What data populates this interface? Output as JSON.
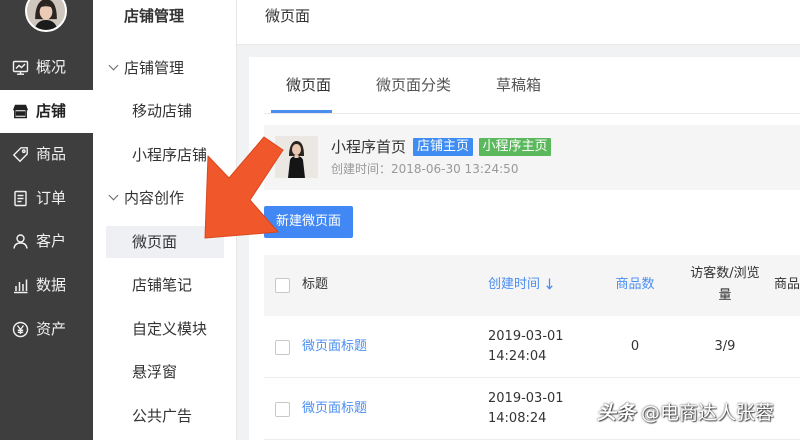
{
  "sidebar": {
    "items": [
      {
        "label": "概况",
        "icon": "dashboard-icon",
        "active": false
      },
      {
        "label": "店铺",
        "icon": "shop-icon",
        "active": true
      },
      {
        "label": "商品",
        "icon": "tag-icon",
        "active": false
      },
      {
        "label": "订单",
        "icon": "order-icon",
        "active": false
      },
      {
        "label": "客户",
        "icon": "user-icon",
        "active": false
      },
      {
        "label": "数据",
        "icon": "chart-icon",
        "active": false
      },
      {
        "label": "资产",
        "icon": "yen-icon",
        "active": false
      }
    ]
  },
  "subnav": {
    "title": "店铺管理",
    "groups": [
      {
        "label": "店铺管理",
        "items": [
          "移动店铺",
          "小程序店铺"
        ]
      },
      {
        "label": "内容创作",
        "items": [
          "微页面",
          "店铺笔记",
          "自定义模块",
          "悬浮窗",
          "公共广告"
        ]
      }
    ],
    "active": "微页面"
  },
  "header": {
    "title": "微页面"
  },
  "tabs": [
    {
      "label": "微页面",
      "active": true
    },
    {
      "label": "微页面分类",
      "active": false
    },
    {
      "label": "草稿箱",
      "active": false
    }
  ],
  "homepage": {
    "title": "小程序首页",
    "badges": [
      {
        "label": "店铺主页",
        "color": "#3f8cf2"
      },
      {
        "label": "小程序主页",
        "color": "#5cb85c"
      }
    ],
    "created": "创建时间：2018-06-30 13:24:50"
  },
  "new_button": {
    "label": "新建微页面",
    "color": "#4288f5"
  },
  "table": {
    "columns": {
      "title": "标题",
      "created": "创建时间",
      "products": "商品数",
      "visitors": "访客数/浏览量",
      "last": "商品"
    },
    "sort_icon": "arrow-down-icon",
    "rows": [
      {
        "title": "微页面标题",
        "date": "2019-03-01",
        "time": "14:24:04",
        "products": "0",
        "visitors": "3/9"
      },
      {
        "title": "微页面标题",
        "date": "2019-03-01",
        "time": "14:08:24"
      }
    ]
  },
  "watermark": {
    "brand": "头条",
    "handle": "@电商达人张蓉"
  },
  "colors": {
    "sidebar_bg": "#3e3e3e",
    "accent": "#4b8ef0",
    "annotation_arrow": "#f0572a"
  }
}
